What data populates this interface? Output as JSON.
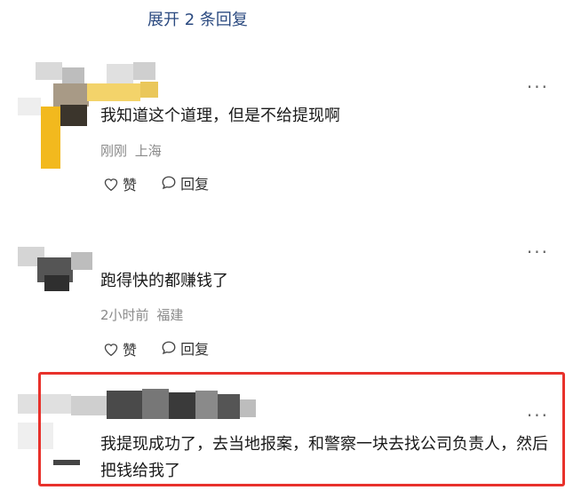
{
  "expand_replies": "展开 2 条回复",
  "comments": [
    {
      "content": "我知道这个道理，但是不给提现啊",
      "time": "刚刚",
      "location": "上海",
      "like_label": "赞",
      "reply_label": "回复",
      "more": "···"
    },
    {
      "content": "跑得快的都赚钱了",
      "time": "2小时前",
      "location": "福建",
      "like_label": "赞",
      "reply_label": "回复",
      "more": "···"
    },
    {
      "content": "我提现成功了，去当地报案，和警察一块去找公司负责人，然后把钱给我了",
      "more": "···"
    }
  ],
  "colors": {
    "link": "#2b4a80",
    "highlight": "#e8312b",
    "meta": "#8a8a8a"
  }
}
